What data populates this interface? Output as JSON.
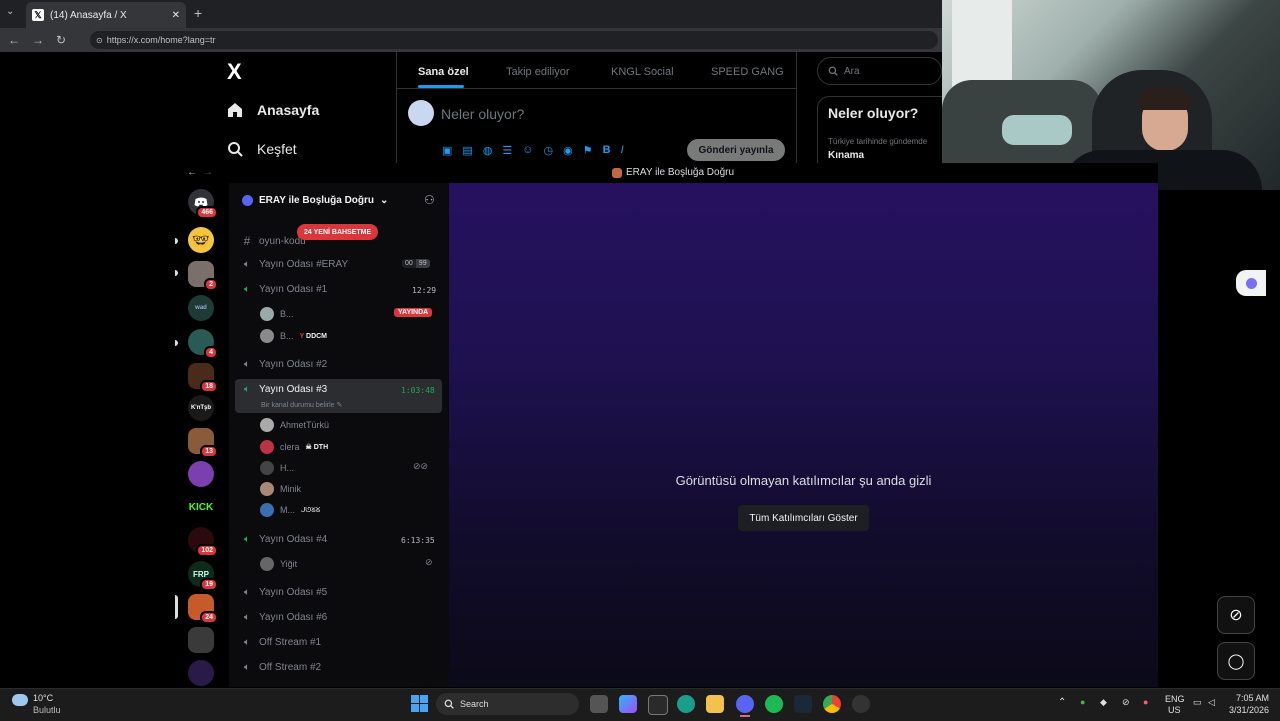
{
  "browser": {
    "tab_title": "(14) Anasayfa / X",
    "url": "https://x.com/home?lang=tr",
    "new_tab_glyph": "+",
    "close_glyph": "✕"
  },
  "twitter": {
    "logo": "X",
    "nav": [
      {
        "label": "Anasayfa",
        "icon": "home-icon"
      },
      {
        "label": "Keşfet",
        "icon": "search-icon"
      }
    ],
    "tabs": [
      "Sana özel",
      "Takip ediliyor",
      "KNGL Social",
      "SPEED GANG"
    ],
    "active_tab": "Sana özel",
    "compose_placeholder": "Neler oluyor?",
    "post_button": "Gönderi yayınla",
    "search_placeholder": "Ara",
    "trends_title": "Neler oluyor?",
    "trend_context": "Türkiye tarihinde gündemde",
    "trend_name": "Kınama",
    "accent": "#1d9bf0"
  },
  "discord": {
    "window_title": "ERAY ile Boşluğa Doğru",
    "server_name": "ERAY ile Boşluğa Doğru",
    "new_mentions_badge": "24 YENİ BAHSETME",
    "servers": [
      {
        "badge": "466",
        "kind": "discord"
      },
      {
        "badge": "",
        "kind": "emoji"
      },
      {
        "badge": "2",
        "kind": "image"
      },
      {
        "badge": "",
        "kind": "text",
        "text": "wad"
      },
      {
        "badge": "4",
        "kind": "image"
      },
      {
        "badge": "18",
        "kind": "image"
      },
      {
        "badge": "",
        "kind": "text",
        "text": "K'nTşb"
      },
      {
        "badge": "13",
        "kind": "image"
      },
      {
        "badge": "",
        "kind": "image"
      },
      {
        "badge": "",
        "kind": "kick",
        "text": "KICK"
      },
      {
        "badge": "102",
        "kind": "image"
      },
      {
        "badge": "19",
        "kind": "text",
        "text": "FRP"
      },
      {
        "badge": "24",
        "kind": "image"
      },
      {
        "badge": "",
        "kind": "image"
      },
      {
        "badge": "",
        "kind": "image"
      }
    ],
    "channels": {
      "text_channel": "oyun-kodu",
      "voice1": {
        "name": "Yayın Odası #ERAY",
        "counts": [
          "00",
          "99"
        ]
      },
      "voice2": {
        "name": "Yayın Odası #1",
        "time": "12:29",
        "live_badge": "YAYINDA",
        "members": [
          "B...",
          "B..."
        ],
        "member_tag": "DDCM"
      },
      "voice3": {
        "name": "Yayın Odası #2"
      },
      "voice4": {
        "name": "Yayın Odası #3",
        "time": "1:03:48",
        "status": "Bir kanal durumu belirle",
        "members": [
          "AhmetTürkü",
          "clera",
          "H...",
          "Minik",
          "M..."
        ],
        "member_tag": "DTH",
        "member_tag2": "ᒍᘎᘜᘜ"
      },
      "voice5": {
        "name": "Yayın Odası #4",
        "time": "6:13:35",
        "members": [
          "Yiğit"
        ]
      },
      "voice6": {
        "name": "Yayın Odası #5"
      },
      "voice7": {
        "name": "Yayın Odası #6"
      },
      "voice8": {
        "name": "Off Stream #1"
      },
      "voice9": {
        "name": "Off Stream #2"
      }
    },
    "stage": {
      "message": "Görüntüsü olmayan katılımcılar şu anda gizli",
      "show_all_button": "Tüm Katılımcıları Göster"
    }
  },
  "taskbar": {
    "weather_temp": "10°C",
    "weather_desc": "Bulutlu",
    "search_label": "Search",
    "lang_top": "ENG",
    "lang_bottom": "US",
    "time": "7:05 AM",
    "date": "3/31/2026"
  }
}
